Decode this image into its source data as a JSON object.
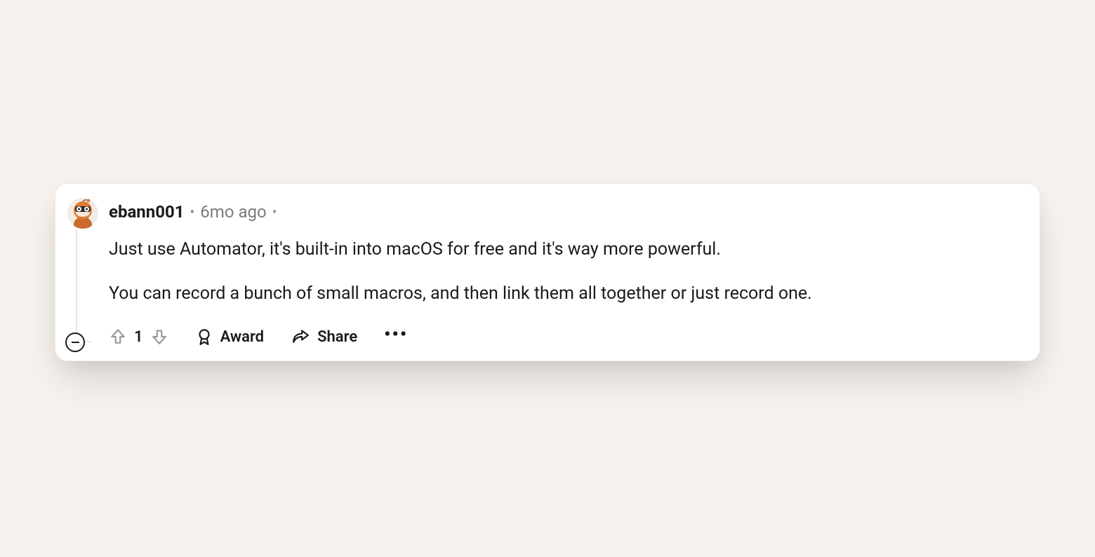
{
  "comment": {
    "username": "ebann001",
    "timestamp": "6mo ago",
    "body": [
      "Just use Automator, it's built-in into macOS for free and it's way more powerful.",
      "You can record a bunch of small macros, and then link them all together or just record one."
    ],
    "vote_count": "1",
    "actions": {
      "award": "Award",
      "share": "Share"
    }
  }
}
